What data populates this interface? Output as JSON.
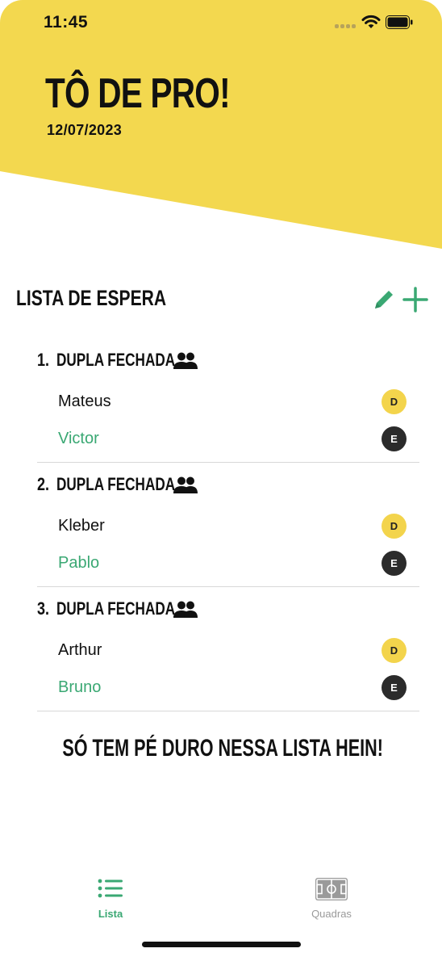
{
  "colors": {
    "banner_yellow": "#f3d84f",
    "accent_green": "#3aa873",
    "badge_d": "#f3d44c",
    "badge_e": "#2b2b2b"
  },
  "status_bar": {
    "time": "11:45"
  },
  "header": {
    "title": "TÔ DE PRO!",
    "date": "12/07/2023"
  },
  "waitlist": {
    "title": "LISTA DE ESPERA",
    "edit_icon": "pencil-icon",
    "add_icon": "plus-icon",
    "groups": [
      {
        "number": "1.",
        "title": "DUPLA FECHADA",
        "icon": "people-icon",
        "players": [
          {
            "name": "Mateus",
            "badge": "D"
          },
          {
            "name": "Victor",
            "badge": "E"
          }
        ]
      },
      {
        "number": "2.",
        "title": "DUPLA FECHADA",
        "icon": "people-icon",
        "players": [
          {
            "name": "Kleber",
            "badge": "D"
          },
          {
            "name": "Pablo",
            "badge": "E"
          }
        ]
      },
      {
        "number": "3.",
        "title": "DUPLA FECHADA",
        "icon": "people-icon",
        "players": [
          {
            "name": "Arthur",
            "badge": "D"
          },
          {
            "name": "Bruno",
            "badge": "E"
          }
        ]
      }
    ],
    "footer_message": "SÓ TEM PÉ DURO NESSA LISTA HEIN!"
  },
  "tabbar": {
    "tabs": [
      {
        "label": "Lista",
        "icon": "list-icon",
        "active": true
      },
      {
        "label": "Quadras",
        "icon": "court-icon",
        "active": false
      }
    ]
  }
}
